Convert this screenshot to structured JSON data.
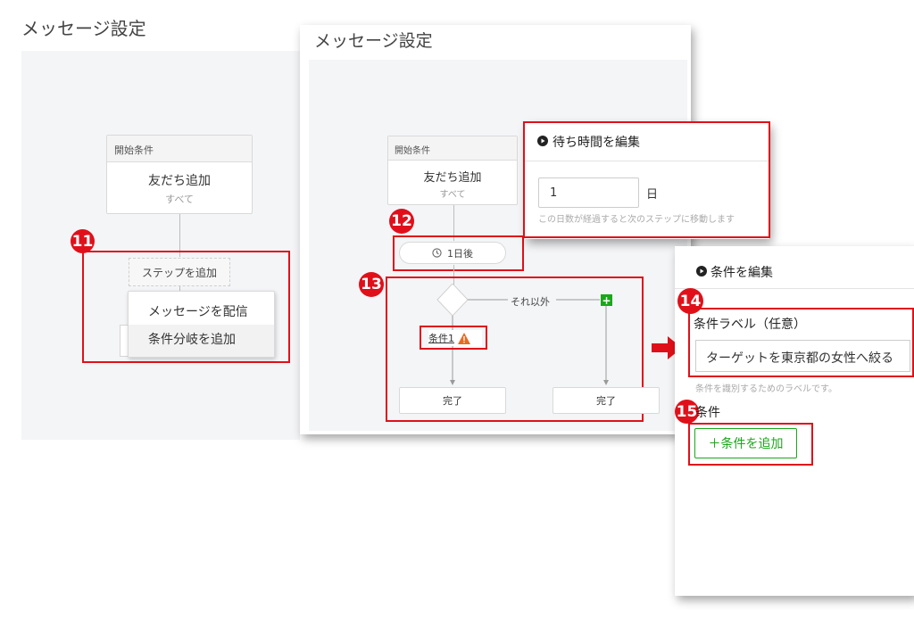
{
  "panel1": {
    "title": "メッセージ設定",
    "start_header": "開始条件",
    "start_title": "友だち追加",
    "start_sub": "すべて",
    "badge": "11",
    "add_step": "ステップを追加",
    "menu": [
      "メッセージを配信",
      "条件分岐を追加"
    ]
  },
  "panel2": {
    "title": "メッセージ設定",
    "start_header": "開始条件",
    "start_title": "友だち追加",
    "start_sub": "すべて",
    "badge12": "12",
    "wait_label": "1日後",
    "badge13": "13",
    "else_label": "それ以外",
    "condition_label": "条件1",
    "done_left": "完了",
    "done_right": "完了"
  },
  "wait_popup": {
    "title": "待ち時間を編集",
    "value": "1",
    "unit": "日",
    "hint": "この日数が経過すると次のステップに移動します"
  },
  "cond_panel": {
    "title": "条件を編集",
    "badge14": "14",
    "label_title": "条件ラベル（任意）",
    "label_value": "ターゲットを東京都の女性へ絞る",
    "label_hint": "条件を識別するためのラベルです。",
    "badge15": "15",
    "cond_title": "条件",
    "add_button": "＋条件を追加"
  },
  "colors": {
    "annotation_red": "#e0101a",
    "add_green": "#1aa71a",
    "canvas": "#f4f5f7"
  }
}
